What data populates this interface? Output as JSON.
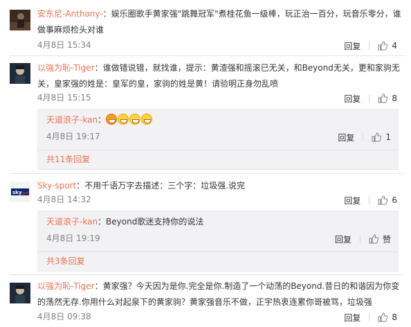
{
  "labels": {
    "reply": "回复",
    "like": "赞"
  },
  "colors": {
    "username": "#eb7350",
    "meta": "#808080",
    "reply_bg": "#f2f2f5"
  },
  "comments": [
    {
      "username": "安东尼-Anthony-",
      "text": "：娱乐圈歌手黄家强\"跳舞冠军\"煮桂花鱼一级棒，玩正治一百分，玩音乐零分，谁做事麻烦检头对谁",
      "time": "4月8日 15:34",
      "likes": "4"
    },
    {
      "username": "以強为恥-Tiger",
      "text": "：谁做错说错，就找谁，提示：黄渣强和摇滚已无关，和Beyond无关，更和家驹无关，皇家强的姓是：皇军的皇，家驹的姓是黄！请验明正身勿乱喷",
      "time": "4月8日 15:15",
      "likes": "8",
      "replies": [
        {
          "username": "天道浪子-kan",
          "text": "：",
          "emoji_count": 4,
          "time": "4月8日 19:17",
          "likes": "1"
        }
      ],
      "more_replies": "共11条回复"
    },
    {
      "username": "Sky-sport",
      "text": "：不用千语万字去描述：三个字：垃圾强.说完",
      "time": "4月8日 14:32",
      "likes": "6",
      "replies": [
        {
          "username": "天道浪子-kan",
          "text": "：Beyond歌迷支持你的说法",
          "time": "4月8日 19:19",
          "likes": "赞"
        }
      ],
      "more_replies": "共3条回复"
    },
    {
      "username": "以強为恥-Tiger",
      "text": "：黄家强？今天因为是你.完全是你.制造了一个动荡的Beyond.昔日的和谐因为你变的荡然无存.你用什么对起泉下的黄家驹？黄家强音乐不做，正宇热衷连累你哥被骂，垃圾强",
      "time": "4月8日 09:38",
      "likes": "8"
    }
  ]
}
